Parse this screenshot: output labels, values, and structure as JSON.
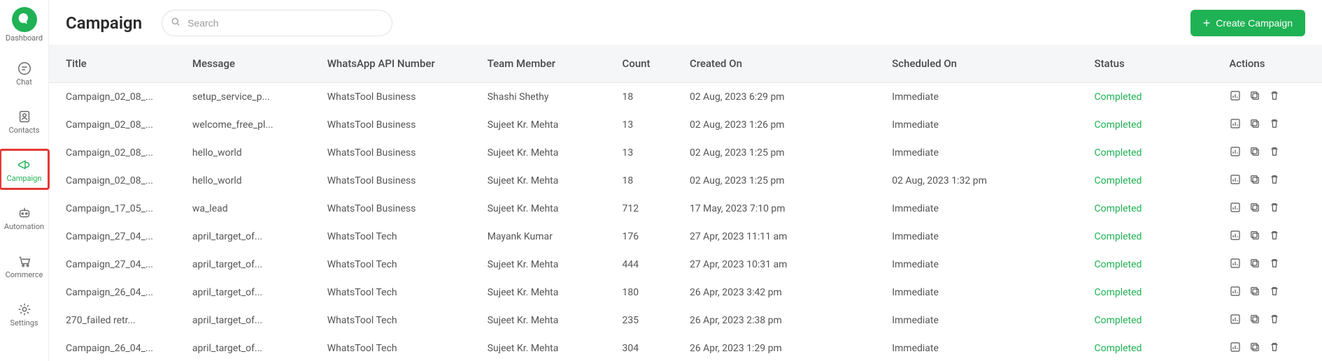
{
  "sidebar": {
    "logo_label": "Dashboard",
    "items": [
      {
        "label": "Chat"
      },
      {
        "label": "Contacts"
      },
      {
        "label": "Campaign"
      },
      {
        "label": "Automation"
      },
      {
        "label": "Commerce"
      },
      {
        "label": "Settings"
      }
    ]
  },
  "header": {
    "title": "Campaign",
    "search_placeholder": "Search",
    "create_button": "Create Campaign"
  },
  "table": {
    "columns": {
      "title": "Title",
      "message": "Message",
      "api": "WhatsApp API Number",
      "member": "Team Member",
      "count": "Count",
      "created": "Created On",
      "scheduled": "Scheduled On",
      "status": "Status",
      "actions": "Actions"
    },
    "rows": [
      {
        "title": "Campaign_02_08_...",
        "message": "setup_service_p...",
        "api": "WhatsTool Business",
        "member": "Shashi Shethy",
        "count": "18",
        "created": "02 Aug, 2023 6:29 pm",
        "scheduled": "Immediate",
        "status": "Completed"
      },
      {
        "title": "Campaign_02_08_...",
        "message": "welcome_free_pl...",
        "api": "WhatsTool Business",
        "member": "Sujeet Kr. Mehta",
        "count": "13",
        "created": "02 Aug, 2023 1:26 pm",
        "scheduled": "Immediate",
        "status": "Completed"
      },
      {
        "title": "Campaign_02_08_...",
        "message": "hello_world",
        "api": "WhatsTool Business",
        "member": "Sujeet Kr. Mehta",
        "count": "13",
        "created": "02 Aug, 2023 1:25 pm",
        "scheduled": "Immediate",
        "status": "Completed"
      },
      {
        "title": "Campaign_02_08_...",
        "message": "hello_world",
        "api": "WhatsTool Business",
        "member": "Sujeet Kr. Mehta",
        "count": "18",
        "created": "02 Aug, 2023 1:25 pm",
        "scheduled": "02 Aug, 2023 1:32 pm",
        "status": "Completed"
      },
      {
        "title": "Campaign_17_05_...",
        "message": "wa_lead",
        "api": "WhatsTool Business",
        "member": "Sujeet Kr. Mehta",
        "count": "712",
        "created": "17 May, 2023 7:10 pm",
        "scheduled": "Immediate",
        "status": "Completed"
      },
      {
        "title": "Campaign_27_04_...",
        "message": "april_target_of...",
        "api": "WhatsTool Tech",
        "member": "Mayank Kumar",
        "count": "176",
        "created": "27 Apr, 2023 11:11 am",
        "scheduled": "Immediate",
        "status": "Completed"
      },
      {
        "title": "Campaign_27_04_...",
        "message": "april_target_of...",
        "api": "WhatsTool Tech",
        "member": "Sujeet Kr. Mehta",
        "count": "444",
        "created": "27 Apr, 2023 10:31 am",
        "scheduled": "Immediate",
        "status": "Completed"
      },
      {
        "title": "Campaign_26_04_...",
        "message": "april_target_of...",
        "api": "WhatsTool Tech",
        "member": "Sujeet Kr. Mehta",
        "count": "180",
        "created": "26 Apr, 2023 3:42 pm",
        "scheduled": "Immediate",
        "status": "Completed"
      },
      {
        "title": "270_failed retr...",
        "message": "april_target_of...",
        "api": "WhatsTool Tech",
        "member": "Sujeet Kr. Mehta",
        "count": "235",
        "created": "26 Apr, 2023 2:38 pm",
        "scheduled": "Immediate",
        "status": "Completed"
      },
      {
        "title": "Campaign_26_04_...",
        "message": "april_target_of...",
        "api": "WhatsTool Tech",
        "member": "Sujeet Kr. Mehta",
        "count": "304",
        "created": "26 Apr, 2023 1:29 pm",
        "scheduled": "Immediate",
        "status": "Completed"
      }
    ]
  }
}
